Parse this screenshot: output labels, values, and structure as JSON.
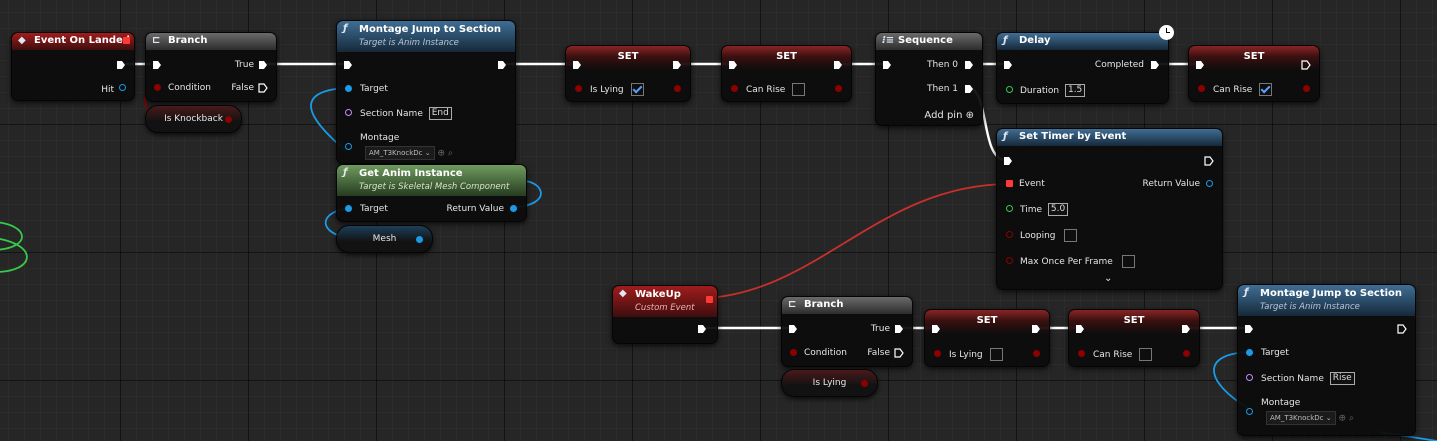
{
  "nodes": {
    "event_on_landed": {
      "title": "Event On Landed",
      "hit": "Hit"
    },
    "branch_top": {
      "title": "Branch",
      "true": "True",
      "false": "False",
      "condition": "Condition"
    },
    "is_knockback": {
      "label": "Is Knockback"
    },
    "montage_jump_top": {
      "title": "Montage Jump to Section",
      "subtitle": "Target is Anim Instance",
      "target": "Target",
      "section_name": "Section Name",
      "section_value": "End",
      "montage": "Montage",
      "montage_value": "AM_T3KnockDc"
    },
    "get_anim_instance": {
      "title": "Get Anim Instance",
      "subtitle": "Target is Skeletal Mesh Component",
      "target": "Target",
      "return_value": "Return Value"
    },
    "mesh": {
      "label": "Mesh"
    },
    "set_lying": {
      "title": "SET",
      "label": "Is Lying",
      "checked": true
    },
    "set_canrise_1": {
      "title": "SET",
      "label": "Can Rise",
      "checked": false
    },
    "sequence": {
      "title": "Sequence",
      "then0": "Then 0",
      "then1": "Then 1",
      "add_pin": "Add pin"
    },
    "delay": {
      "title": "Delay",
      "completed": "Completed",
      "duration": "Duration",
      "duration_value": "1.5"
    },
    "set_canrise_2": {
      "title": "SET",
      "label": "Can Rise",
      "checked": true
    },
    "set_timer": {
      "title": "Set Timer by Event",
      "event": "Event",
      "return_value": "Return Value",
      "time": "Time",
      "time_value": "5.0",
      "looping": "Looping",
      "max_once": "Max Once Per Frame",
      "expand": "⌄"
    },
    "wakeup": {
      "title": "WakeUp",
      "subtitle": "Custom Event"
    },
    "branch_bottom": {
      "title": "Branch",
      "true": "True",
      "false": "False",
      "condition": "Condition"
    },
    "is_lying": {
      "label": "Is Lying"
    },
    "set_lying_2": {
      "title": "SET",
      "label": "Is Lying",
      "checked": false
    },
    "set_canrise_3": {
      "title": "SET",
      "label": "Can Rise",
      "checked": false
    },
    "montage_jump_bottom": {
      "title": "Montage Jump to Section",
      "subtitle": "Target is Anim Instance",
      "target": "Target",
      "section_name": "Section Name",
      "section_value": "Rise",
      "montage": "Montage",
      "montage_value": "AM_T3KnockDc"
    }
  },
  "colors": {
    "exec": "#ffffff",
    "bool": "#8c0000",
    "object": "#1a9ae8",
    "float": "#36c94a",
    "name": "#c58cff",
    "delegate": "#ff3838"
  },
  "icons": {
    "function": "function-icon",
    "branch": "branch-icon",
    "sequence": "sequence-icon",
    "event": "event-icon",
    "latent": "clock-icon"
  }
}
